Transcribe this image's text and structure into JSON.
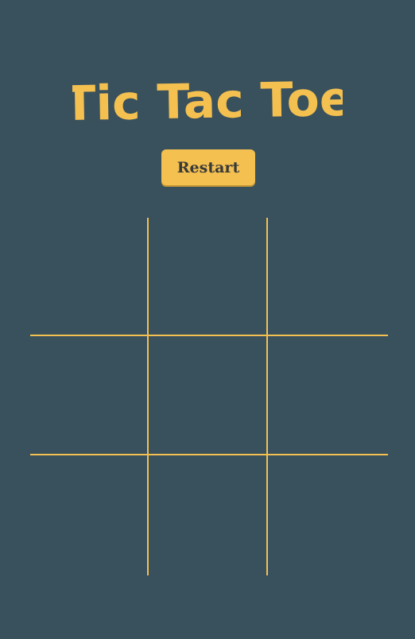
{
  "title": "Tic Tac Toe",
  "restart_label": "Restart",
  "board": {
    "cells": [
      "",
      "",
      "",
      "",
      "",
      "",
      "",
      "",
      ""
    ]
  },
  "colors": {
    "background": "#39505d",
    "accent": "#f4c04f",
    "button_text": "#3a3a3a"
  }
}
